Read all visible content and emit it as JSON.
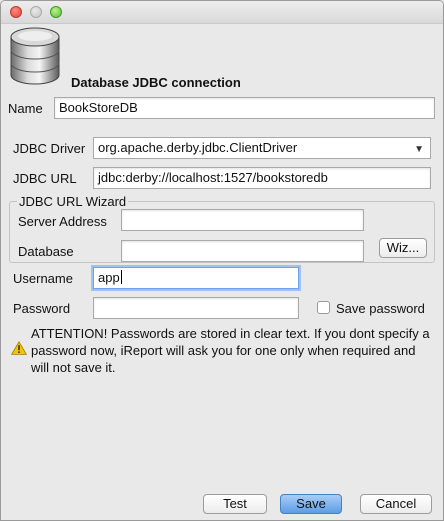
{
  "dialog": {
    "header_title": "Database JDBC connection"
  },
  "form": {
    "name": {
      "label": "Name",
      "value": "BookStoreDB"
    },
    "jdbc_driver": {
      "label": "JDBC Driver",
      "value": "org.apache.derby.jdbc.ClientDriver"
    },
    "jdbc_url": {
      "label": "JDBC URL",
      "value": "jdbc:derby://localhost:1527/bookstoredb"
    },
    "wizard": {
      "legend": "JDBC URL Wizard",
      "server_address": {
        "label": "Server Address",
        "value": ""
      },
      "database": {
        "label": "Database",
        "value": ""
      },
      "wizard_button": "Wiz..."
    },
    "username": {
      "label": "Username",
      "value": "app"
    },
    "password": {
      "label": "Password",
      "value": ""
    },
    "save_password": {
      "label": "Save password",
      "checked": false
    }
  },
  "warning": {
    "icon": "warning-triangle-icon",
    "text": "ATTENTION! Passwords are stored in clear text. If you dont specify a password now, iReport will ask you for one only when required and will not save it."
  },
  "buttons": {
    "test": "Test",
    "save": "Save",
    "cancel": "Cancel"
  },
  "colors": {
    "primary_button": "#5d9de6",
    "focus_ring": "#9ec3f2",
    "warning": "#f0b400"
  }
}
